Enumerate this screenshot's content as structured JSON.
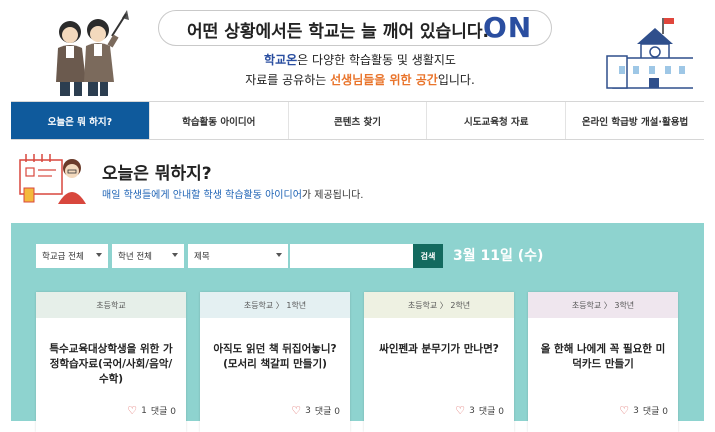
{
  "header": {
    "slogan": "어떤 상황에서든 학교는 늘 깨어 있습니다.",
    "slogan_on": "ON",
    "intro_brand": "학교온",
    "intro_line1_rest": "은 다양한 학습활동 및 생활지도",
    "intro_line2_pre": "자료를 공유하는 ",
    "intro_line2_hl": "선생님들을 위한 공간",
    "intro_line2_post": "입니다."
  },
  "nav": {
    "items": [
      {
        "label": "오늘은 뭐 하지?"
      },
      {
        "label": "학습활동 아이디어"
      },
      {
        "label": "콘텐츠 찾기"
      },
      {
        "label": "시도교육청 자료"
      },
      {
        "label": "온라인 학급방 개설·활용법"
      }
    ]
  },
  "section": {
    "title": "오늘은 뭐하지?",
    "desc_blue": "매일 학생들에게 안내할 학생 학습활동 아이디어",
    "desc_rest": "가 제공됩니다."
  },
  "filters": {
    "school_level": "학교급 전체",
    "grade": "학년 전체",
    "field": "제목",
    "search_label": "검색",
    "date": "3월 11일 (수)"
  },
  "cards": [
    {
      "category": "초등학교",
      "title": "특수교육대상학생을 위한 가정학습자료(국어/사회/음악/수학)",
      "likes": "1",
      "comments": "댓글 0",
      "head_color": "#e6efe9"
    },
    {
      "category": "초등학교 〉 1학년",
      "title": "아직도 읽던 책 뒤집어놓니? (모서리 책갈피 만들기)",
      "likes": "3",
      "comments": "댓글 0",
      "head_color": "#e4f0f2"
    },
    {
      "category": "초등학교 〉 2학년",
      "title": "싸인펜과 분무기가 만나면?",
      "likes": "3",
      "comments": "댓글 0",
      "head_color": "#eef1e2"
    },
    {
      "category": "초등학교 〉 3학년",
      "title": "올 한해 나에게 꼭 필요한 미덕카드 만들기",
      "likes": "3",
      "comments": "댓글 0",
      "head_color": "#efe6ee"
    }
  ]
}
